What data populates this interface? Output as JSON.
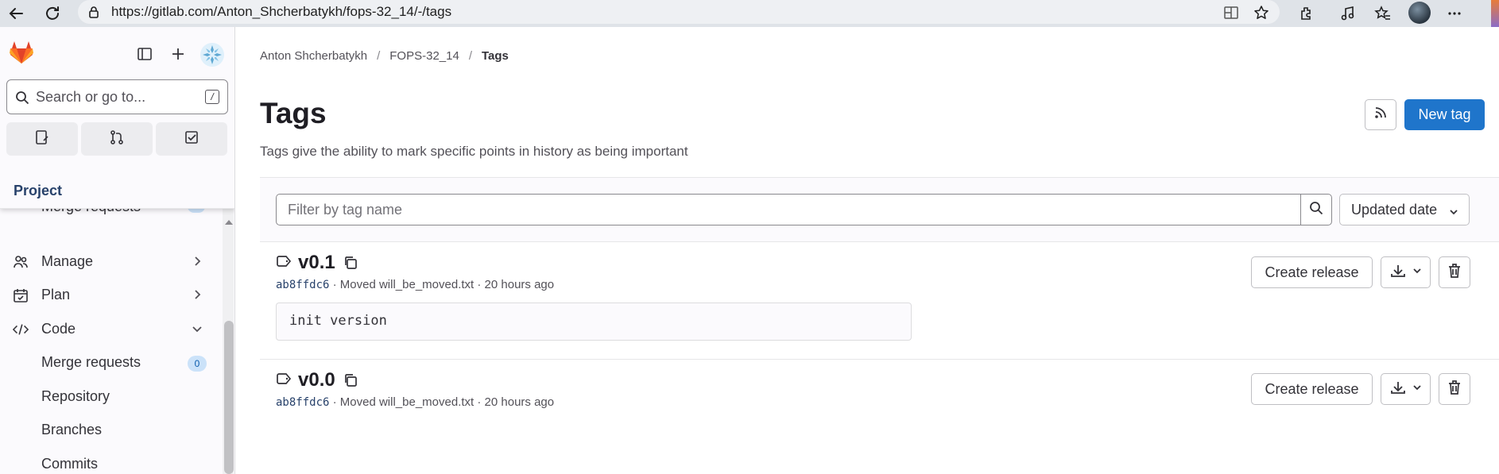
{
  "browser": {
    "url": "https://gitlab.com/Anton_Shcherbatykh/fops-32_14/-/tags",
    "icons": [
      "back-icon",
      "refresh-icon",
      "lock-icon",
      "split-view-icon",
      "favorite-star-icon",
      "extensions-icon",
      "media-icon",
      "favorites-icon",
      "profile-avatar",
      "more-icon"
    ]
  },
  "sidebar": {
    "search_placeholder": "Search or go to...",
    "search_shortcut": "/",
    "section_title": "Project",
    "peek_item": "Merge requests",
    "nav": [
      {
        "label": "Manage",
        "icon": "users-icon",
        "expanded": false
      },
      {
        "label": "Plan",
        "icon": "calendar-icon",
        "expanded": false
      },
      {
        "label": "Code",
        "icon": "code-icon",
        "expanded": true
      }
    ],
    "code_subitems": [
      {
        "label": "Merge requests",
        "count": "0"
      },
      {
        "label": "Repository"
      },
      {
        "label": "Branches"
      },
      {
        "label": "Commits"
      }
    ]
  },
  "breadcrumb": [
    "Anton Shcherbatykh",
    "FOPS-32_14",
    "Tags"
  ],
  "page": {
    "title": "Tags",
    "description": "Tags give the ability to mark specific points in history as being important",
    "new_tag_label": "New tag"
  },
  "filter": {
    "placeholder": "Filter by tag name",
    "sort_label": "Updated date"
  },
  "tags": [
    {
      "name": "v0.1",
      "sha": "ab8ffdc6",
      "commit_message": "Moved will_be_moved.txt",
      "time": "20 hours ago",
      "message": "init version",
      "release_label": "Create release"
    },
    {
      "name": "v0.0",
      "sha": "ab8ffdc6",
      "commit_message": "Moved will_be_moved.txt",
      "time": "20 hours ago",
      "release_label": "Create release"
    }
  ],
  "colors": {
    "primary": "#1f75cb",
    "sidebar_bg": "#fbfafd",
    "project_label": "#28426b",
    "badge_bg": "#cbe2f9"
  }
}
